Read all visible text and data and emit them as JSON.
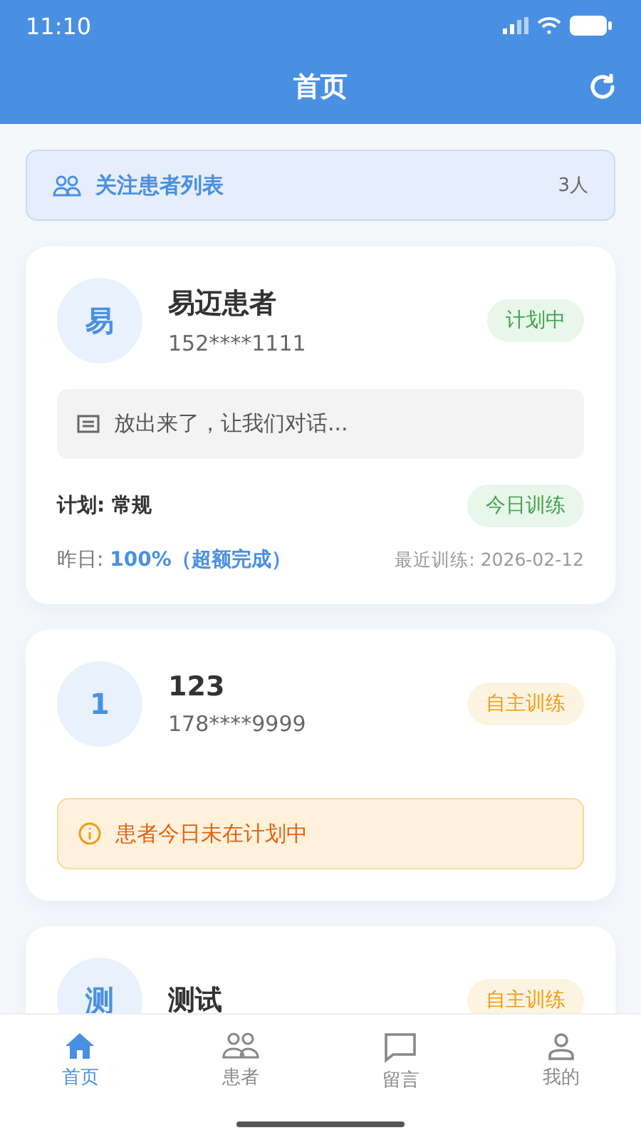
{
  "status_bar": {
    "time": "11:10"
  },
  "header": {
    "title": "首页"
  },
  "focus_bar": {
    "label": "关注患者列表",
    "count": "3人"
  },
  "patients": [
    {
      "avatar": "易",
      "name": "易迈患者",
      "phone": "152****1111",
      "badge": {
        "label": "计划中",
        "kind": "plan"
      },
      "message": "放出来了，让我们对话...",
      "plan": "计划: 常规",
      "plan_badge": {
        "label": "今日训练",
        "kind": "plan"
      },
      "yesterday_label": "昨日: ",
      "yesterday_value": "100%（超额完成）",
      "last_training": "最近训练: 2026-02-12"
    },
    {
      "avatar": "1",
      "name": "123",
      "phone": "178****9999",
      "badge": {
        "label": "自主训练",
        "kind": "self"
      },
      "alert": "患者今日未在计划中"
    },
    {
      "avatar": "测",
      "name": "测试",
      "badge": {
        "label": "自主训练",
        "kind": "self"
      }
    }
  ],
  "tabs": [
    {
      "label": "首页",
      "kind": "home",
      "selected": true
    },
    {
      "label": "患者",
      "kind": "users",
      "selected": false
    },
    {
      "label": "留言",
      "kind": "message",
      "selected": false
    },
    {
      "label": "我的",
      "kind": "user",
      "selected": false
    }
  ]
}
